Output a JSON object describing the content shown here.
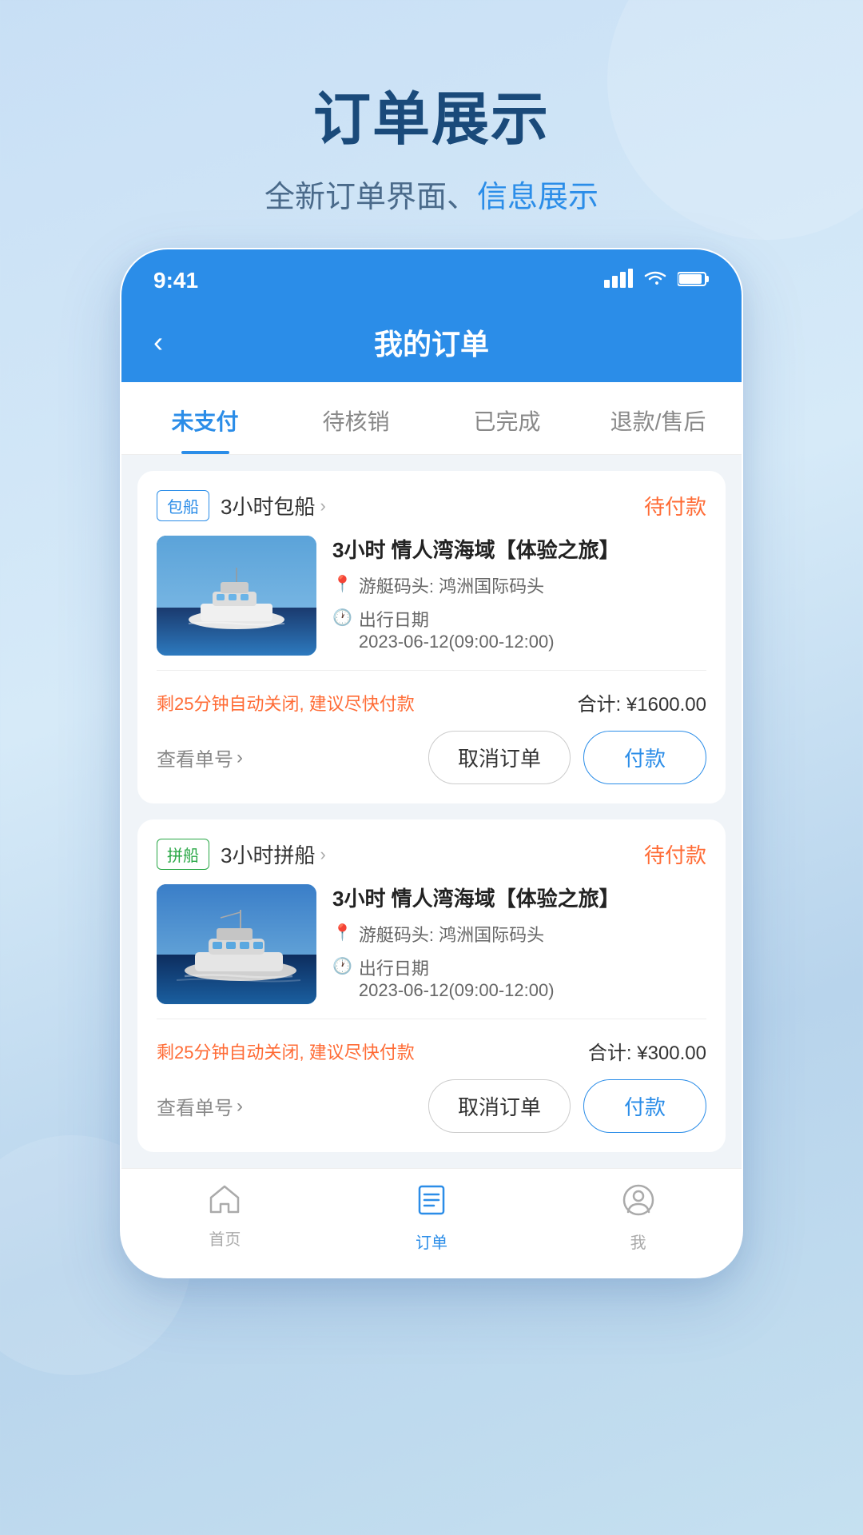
{
  "page": {
    "title": "订单展示",
    "subtitle_plain": "全新订单界面、",
    "subtitle_highlight": "信息展示"
  },
  "status_bar": {
    "time": "9:41",
    "signal": "▐▐▐",
    "wifi": "WiFi",
    "battery": "🔋"
  },
  "nav": {
    "back_icon": "‹",
    "title": "我的订单"
  },
  "tabs": [
    {
      "label": "未支付",
      "active": true
    },
    {
      "label": "待核销",
      "active": false
    },
    {
      "label": "已完成",
      "active": false
    },
    {
      "label": "退款/售后",
      "active": false
    }
  ],
  "orders": [
    {
      "tag": "包船",
      "tag_type": "blue",
      "type_name": "3小时包船",
      "status": "待付款",
      "order_name": "3小时 情人湾海域【体验之旅】",
      "dock": "游艇码头: 鸿洲国际码头",
      "date_label": "出行日期",
      "date_value": "2023-06-12(09:00-12:00)",
      "countdown": "剩25分钟自动关闭, 建议尽快付款",
      "total_label": "合计: ¥1600.00",
      "view_order_no": "查看单号",
      "btn_cancel": "取消订单",
      "btn_pay": "付款"
    },
    {
      "tag": "拼船",
      "tag_type": "green",
      "type_name": "3小时拼船",
      "status": "待付款",
      "order_name": "3小时 情人湾海域【体验之旅】",
      "dock": "游艇码头: 鸿洲国际码头",
      "date_label": "出行日期",
      "date_value": "2023-06-12(09:00-12:00)",
      "countdown": "剩25分钟自动关闭, 建议尽快付款",
      "total_label": "合计: ¥300.00",
      "view_order_no": "查看单号",
      "btn_cancel": "取消订单",
      "btn_pay": "付款"
    }
  ],
  "bottom_nav": [
    {
      "icon": "⌂",
      "label": "首页",
      "active": false
    },
    {
      "icon": "☰",
      "label": "订单",
      "active": true
    },
    {
      "icon": "◎",
      "label": "我",
      "active": false
    }
  ]
}
